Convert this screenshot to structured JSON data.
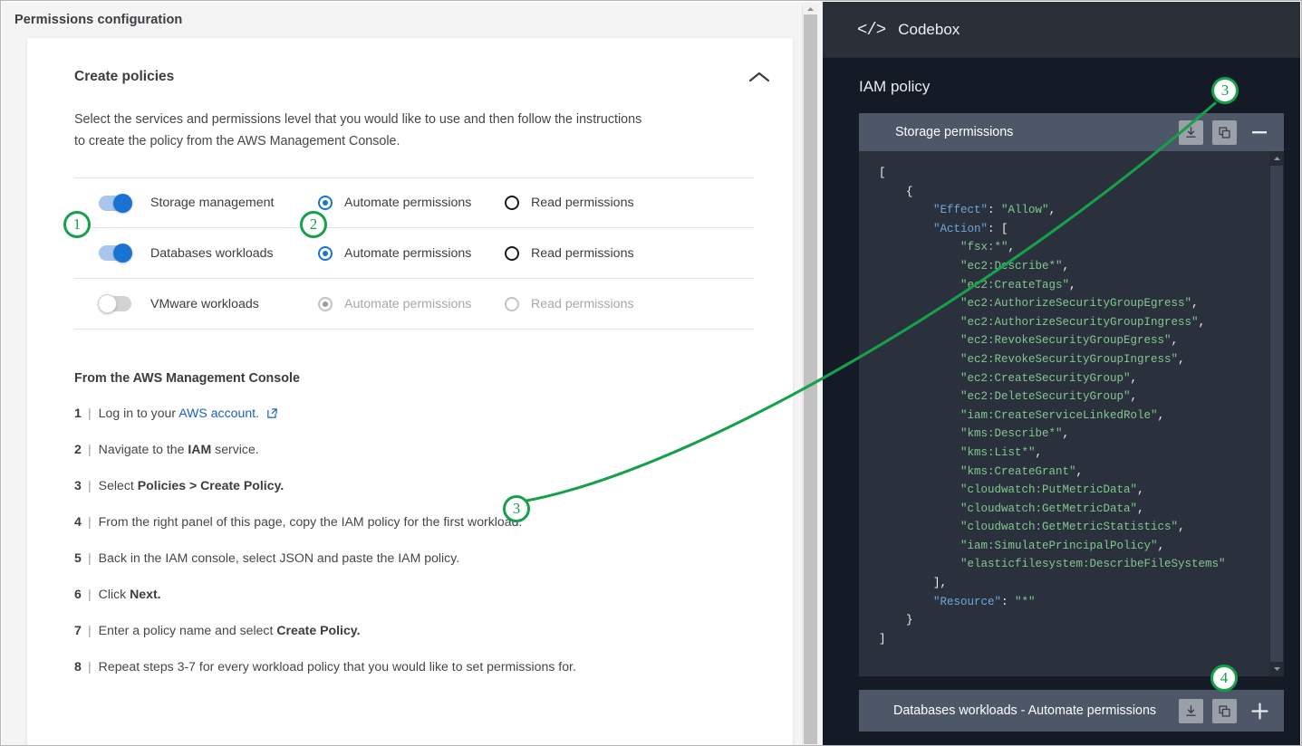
{
  "left": {
    "header_title": "Permissions configuration",
    "section_title": "Create policies",
    "collapse_icon": "chevron-up-icon",
    "intro_line1": "Select the services and permissions level that you would like to use and then follow the instructions",
    "intro_line2": "to create the policy from the AWS Management Console.",
    "permission_rows": [
      {
        "toggle_state": "on",
        "label": "Storage management",
        "option_automate": "Automate permissions",
        "option_read": "Read permissions",
        "selected": "automate",
        "disabled": false
      },
      {
        "toggle_state": "on",
        "label": "Databases workloads",
        "option_automate": "Automate permissions",
        "option_read": "Read permissions",
        "selected": "automate",
        "disabled": false
      },
      {
        "toggle_state": "off",
        "label": "VMware workloads",
        "option_automate": "Automate permissions",
        "option_read": "Read permissions",
        "selected": "automate",
        "disabled": true
      }
    ],
    "steps_title": "From the AWS Management Console",
    "steps": [
      {
        "num": "1",
        "prefix": "Log in to your ",
        "link": "AWS account.",
        "suffix": "",
        "bold": "",
        "external_icon": "external-link-icon"
      },
      {
        "num": "2",
        "prefix": "Navigate to the ",
        "bold": "IAM",
        "suffix": " service."
      },
      {
        "num": "3",
        "prefix": "Select ",
        "bold": "Policies > Create Policy.",
        "suffix": ""
      },
      {
        "num": "4",
        "prefix": "From the right panel of this page, copy the IAM policy for the first workload.",
        "bold": "",
        "suffix": ""
      },
      {
        "num": "5",
        "prefix": "Back in the IAM console, select JSON and paste the IAM policy.",
        "bold": "",
        "suffix": ""
      },
      {
        "num": "6",
        "prefix": "Click ",
        "bold": "Next.",
        "suffix": ""
      },
      {
        "num": "7",
        "prefix": "Enter a policy name and select ",
        "bold": "Create Policy.",
        "suffix": ""
      },
      {
        "num": "8",
        "prefix": "Repeat steps 3-7 for every workload policy that you would like to set permissions for.",
        "bold": "",
        "suffix": ""
      }
    ]
  },
  "right": {
    "codebox_tag": "</>",
    "codebox_title": "Codebox",
    "iam_title": "IAM policy",
    "policy_panel": {
      "title": "Storage permissions",
      "download_icon": "download-icon",
      "copy_icon": "copy-icon",
      "minimize_icon": "minus-icon"
    },
    "code_lines": [
      {
        "indent": 0,
        "parts": [
          {
            "t": "pun",
            "v": "["
          }
        ]
      },
      {
        "indent": 1,
        "parts": [
          {
            "t": "pun",
            "v": "{"
          }
        ]
      },
      {
        "indent": 2,
        "parts": [
          {
            "t": "key",
            "v": "\"Effect\""
          },
          {
            "t": "pun",
            "v": ": "
          },
          {
            "t": "str",
            "v": "\"Allow\""
          },
          {
            "t": "pun",
            "v": ","
          }
        ]
      },
      {
        "indent": 2,
        "parts": [
          {
            "t": "key",
            "v": "\"Action\""
          },
          {
            "t": "pun",
            "v": ": ["
          }
        ]
      },
      {
        "indent": 3,
        "parts": [
          {
            "t": "str",
            "v": "\"fsx:*\""
          },
          {
            "t": "pun",
            "v": ","
          }
        ]
      },
      {
        "indent": 3,
        "parts": [
          {
            "t": "str",
            "v": "\"ec2:Describe*\""
          },
          {
            "t": "pun",
            "v": ","
          }
        ]
      },
      {
        "indent": 3,
        "parts": [
          {
            "t": "str",
            "v": "\"ec2:CreateTags\""
          },
          {
            "t": "pun",
            "v": ","
          }
        ]
      },
      {
        "indent": 3,
        "parts": [
          {
            "t": "str",
            "v": "\"ec2:AuthorizeSecurityGroupEgress\""
          },
          {
            "t": "pun",
            "v": ","
          }
        ]
      },
      {
        "indent": 3,
        "parts": [
          {
            "t": "str",
            "v": "\"ec2:AuthorizeSecurityGroupIngress\""
          },
          {
            "t": "pun",
            "v": ","
          }
        ]
      },
      {
        "indent": 3,
        "parts": [
          {
            "t": "str",
            "v": "\"ec2:RevokeSecurityGroupEgress\""
          },
          {
            "t": "pun",
            "v": ","
          }
        ]
      },
      {
        "indent": 3,
        "parts": [
          {
            "t": "str",
            "v": "\"ec2:RevokeSecurityGroupIngress\""
          },
          {
            "t": "pun",
            "v": ","
          }
        ]
      },
      {
        "indent": 3,
        "parts": [
          {
            "t": "str",
            "v": "\"ec2:CreateSecurityGroup\""
          },
          {
            "t": "pun",
            "v": ","
          }
        ]
      },
      {
        "indent": 3,
        "parts": [
          {
            "t": "str",
            "v": "\"ec2:DeleteSecurityGroup\""
          },
          {
            "t": "pun",
            "v": ","
          }
        ]
      },
      {
        "indent": 3,
        "parts": [
          {
            "t": "str",
            "v": "\"iam:CreateServiceLinkedRole\""
          },
          {
            "t": "pun",
            "v": ","
          }
        ]
      },
      {
        "indent": 3,
        "parts": [
          {
            "t": "str",
            "v": "\"kms:Describe*\""
          },
          {
            "t": "pun",
            "v": ","
          }
        ]
      },
      {
        "indent": 3,
        "parts": [
          {
            "t": "str",
            "v": "\"kms:List*\""
          },
          {
            "t": "pun",
            "v": ","
          }
        ]
      },
      {
        "indent": 3,
        "parts": [
          {
            "t": "str",
            "v": "\"kms:CreateGrant\""
          },
          {
            "t": "pun",
            "v": ","
          }
        ]
      },
      {
        "indent": 3,
        "parts": [
          {
            "t": "str",
            "v": "\"cloudwatch:PutMetricData\""
          },
          {
            "t": "pun",
            "v": ","
          }
        ]
      },
      {
        "indent": 3,
        "parts": [
          {
            "t": "str",
            "v": "\"cloudwatch:GetMetricData\""
          },
          {
            "t": "pun",
            "v": ","
          }
        ]
      },
      {
        "indent": 3,
        "parts": [
          {
            "t": "str",
            "v": "\"cloudwatch:GetMetricStatistics\""
          },
          {
            "t": "pun",
            "v": ","
          }
        ]
      },
      {
        "indent": 3,
        "parts": [
          {
            "t": "str",
            "v": "\"iam:SimulatePrincipalPolicy\""
          },
          {
            "t": "pun",
            "v": ","
          }
        ]
      },
      {
        "indent": 3,
        "parts": [
          {
            "t": "str",
            "v": "\"elasticfilesystem:DescribeFileSystems\""
          }
        ]
      },
      {
        "indent": 2,
        "parts": [
          {
            "t": "pun",
            "v": "],"
          }
        ]
      },
      {
        "indent": 2,
        "parts": [
          {
            "t": "key",
            "v": "\"Resource\""
          },
          {
            "t": "pun",
            "v": ": "
          },
          {
            "t": "str",
            "v": "\"*\""
          }
        ]
      },
      {
        "indent": 1,
        "parts": [
          {
            "t": "pun",
            "v": "}"
          }
        ]
      },
      {
        "indent": 0,
        "parts": [
          {
            "t": "pun",
            "v": "]"
          }
        ]
      }
    ],
    "bottom_panel": {
      "title": "Databases workloads - Automate permissions",
      "download_icon": "download-icon",
      "copy_icon": "copy-icon",
      "add_icon": "plus-icon"
    }
  },
  "annotations": {
    "markers": [
      {
        "id": "1",
        "label": "1"
      },
      {
        "id": "2",
        "label": "2"
      },
      {
        "id": "3a",
        "label": "3"
      },
      {
        "id": "3b",
        "label": "3"
      },
      {
        "id": "4",
        "label": "4"
      }
    ],
    "accent_color": "#17a04a"
  }
}
